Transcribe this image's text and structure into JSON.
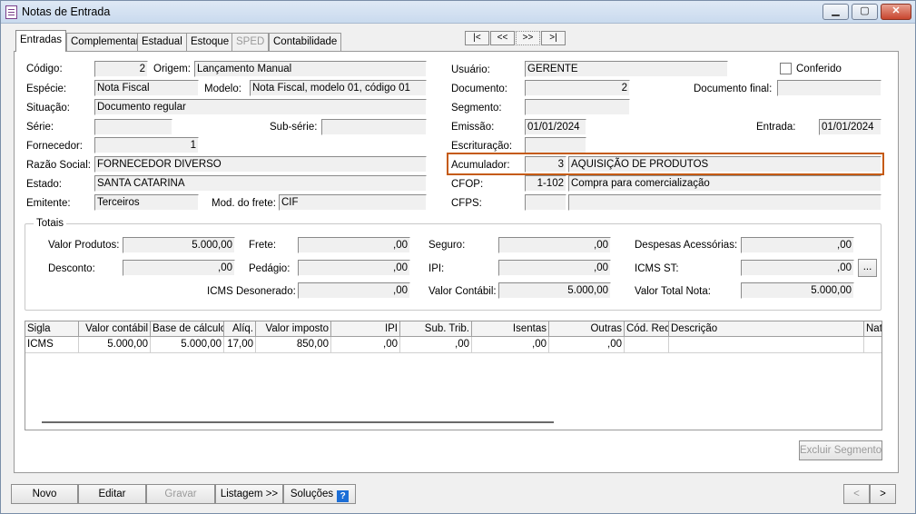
{
  "window": {
    "title": "Notas de Entrada",
    "minimize": "▁",
    "maximize": "▢",
    "close": "✕"
  },
  "tabs": [
    {
      "label": "Entradas",
      "active": true
    },
    {
      "label": "Complementar"
    },
    {
      "label": "Estadual"
    },
    {
      "label": "Estoque"
    },
    {
      "label": "SPED",
      "disabled": true
    },
    {
      "label": "Contabilidade"
    }
  ],
  "nav": {
    "first": "|<",
    "prev": "<<",
    "next": ">>",
    "last": ">|"
  },
  "form": {
    "codigo": {
      "label": "Código:",
      "value": "2"
    },
    "origem": {
      "label": "Origem:",
      "value": "Lançamento Manual"
    },
    "especie": {
      "label": "Espécie:",
      "value": "Nota Fiscal"
    },
    "modelo": {
      "label": "Modelo:",
      "value": "Nota Fiscal, modelo 01, código 01"
    },
    "situacao": {
      "label": "Situação:",
      "value": "Documento regular"
    },
    "serie": {
      "label": "Série:",
      "value": ""
    },
    "subserie": {
      "label": "Sub-série:",
      "value": ""
    },
    "fornecedor": {
      "label": "Fornecedor:",
      "value": "1"
    },
    "razao_social": {
      "label": "Razão Social:",
      "value": "FORNECEDOR DIVERSO"
    },
    "estado": {
      "label": "Estado:",
      "value": "SANTA CATARINA"
    },
    "emitente": {
      "label": "Emitente:",
      "value": "Terceiros"
    },
    "mod_frete": {
      "label": "Mod. do frete:",
      "value": "CIF"
    },
    "usuario": {
      "label": "Usuário:",
      "value": "GERENTE"
    },
    "conferido": {
      "label": "Conferido"
    },
    "documento": {
      "label": "Documento:",
      "value": "2"
    },
    "documento_final": {
      "label": "Documento final:",
      "value": ""
    },
    "segmento": {
      "label": "Segmento:",
      "value": ""
    },
    "emissao": {
      "label": "Emissão:",
      "value": "01/01/2024"
    },
    "entrada": {
      "label": "Entrada:",
      "value": "01/01/2024"
    },
    "escrituracao": {
      "label": "Escrituração:",
      "value": ""
    },
    "acumulador": {
      "label": "Acumulador:",
      "code": "3",
      "desc": "AQUISIÇÃO DE PRODUTOS"
    },
    "cfop": {
      "label": "CFOP:",
      "code": "1-102",
      "desc": "Compra para comercialização"
    },
    "cfps": {
      "label": "CFPS:",
      "code": "",
      "desc": ""
    }
  },
  "totais": {
    "title": "Totais",
    "valor_produtos": {
      "label": "Valor Produtos:",
      "value": "5.000,00"
    },
    "frete": {
      "label": "Frete:",
      "value": ",00"
    },
    "seguro": {
      "label": "Seguro:",
      "value": ",00"
    },
    "despesas": {
      "label": "Despesas Acessórias:",
      "value": ",00"
    },
    "desconto": {
      "label": "Desconto:",
      "value": ",00"
    },
    "pedagio": {
      "label": "Pedágio:",
      "value": ",00"
    },
    "ipi": {
      "label": "IPI:",
      "value": ",00"
    },
    "icms_st": {
      "label": "ICMS ST:",
      "value": ",00",
      "button": "..."
    },
    "icms_desonerado": {
      "label": "ICMS Desonerado:",
      "value": ",00"
    },
    "valor_contabil": {
      "label": "Valor Contábil:",
      "value": "5.000,00"
    },
    "valor_total": {
      "label": "Valor Total Nota:",
      "value": "5.000,00"
    }
  },
  "grid": {
    "columns": [
      "Sigla",
      "Valor contábil",
      "Base de cálculo",
      "Alíq.",
      "Valor imposto",
      "IPI",
      "Sub. Trib.",
      "Isentas",
      "Outras",
      "Cód. Rec.",
      "Descrição",
      "Nat."
    ],
    "rows": [
      [
        "ICMS",
        "5.000,00",
        "5.000,00",
        "17,00",
        "850,00",
        ",00",
        ",00",
        ",00",
        ",00",
        "",
        "",
        ""
      ]
    ]
  },
  "buttons": {
    "excluir_segmento": "Excluir Segmento",
    "novo": "Novo",
    "editar": "Editar",
    "gravar": "Gravar",
    "listagem": "Listagem >>",
    "solucoes": "Soluções",
    "help": "?",
    "prev": "<",
    "next": ">"
  }
}
